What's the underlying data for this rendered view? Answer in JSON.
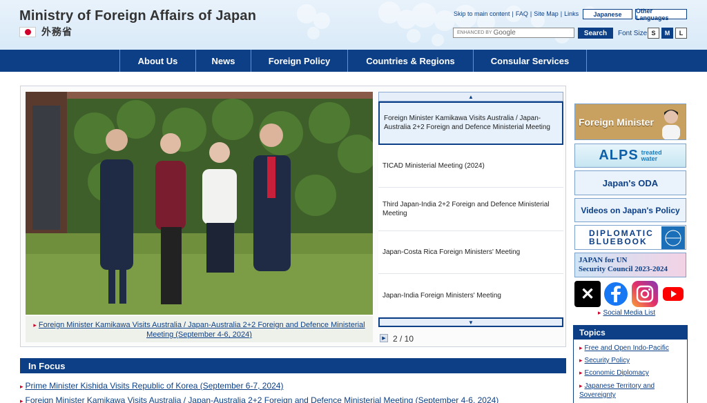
{
  "header": {
    "site_title": "Ministry of Foreign Affairs of Japan",
    "jp_name": "外務省",
    "top_links": [
      "Skip to main content",
      "FAQ",
      "Site Map",
      "Links"
    ],
    "lang_japanese": "Japanese",
    "lang_other": "Other Languages",
    "search_placeholder_prefix": "ENHANCED BY",
    "search_placeholder_brand": "Google",
    "search_button": "Search",
    "font_size_label": "Font Size",
    "font_sizes": [
      "S",
      "M",
      "L"
    ]
  },
  "nav": {
    "items": [
      "About Us",
      "News",
      "Foreign Policy",
      "Countries & Regions",
      "Consular Services"
    ]
  },
  "slider": {
    "caption": "Foreign Minister Kamikawa Visits Australia / Japan-Australia 2+2 Foreign and Defence Ministerial Meeting (September 4-6, 2024)",
    "items": [
      "Foreign Minister Kamikawa Visits Australia / Japan-Australia 2+2 Foreign and Defence Ministerial Meeting",
      "TICAD Ministerial Meeting (2024)",
      "Third Japan-India 2+2 Foreign and Defence Ministerial Meeting",
      "Japan-Costa Rica Foreign Ministers' Meeting",
      "Japan-India Foreign Ministers' Meeting"
    ],
    "pager": "2 / 10"
  },
  "focus": {
    "heading": "In Focus",
    "items": [
      "Prime Minister Kishida Visits Republic of Korea (September 6-7, 2024)",
      "Foreign Minister Kamikawa Visits Australia / Japan-Australia 2+2 Foreign and Defence Ministerial Meeting (September 4-6, 2024)"
    ]
  },
  "sidebar": {
    "banners": {
      "foreign_minister": "Foreign Minister",
      "alps_main": "ALPS",
      "alps_sub1": "treated",
      "alps_sub2": "water",
      "oda": "Japan's ODA",
      "videos": "Videos on Japan's Policy",
      "bluebook1": "DIPLOMATIC",
      "bluebook2": "BLUEBOOK",
      "un1": "JAPAN for UN",
      "un2": "Security Council 2023-2024"
    },
    "social_link": "Social Media List",
    "topics_heading": "Topics",
    "topics": [
      "Free and Open Indo-Pacific",
      "Security Policy",
      "Economic Diplomacy",
      "Japanese Territory and Sovereignty"
    ]
  },
  "colors": {
    "brand_navy": "#0d3f86",
    "flag_red": "#d0002a"
  }
}
